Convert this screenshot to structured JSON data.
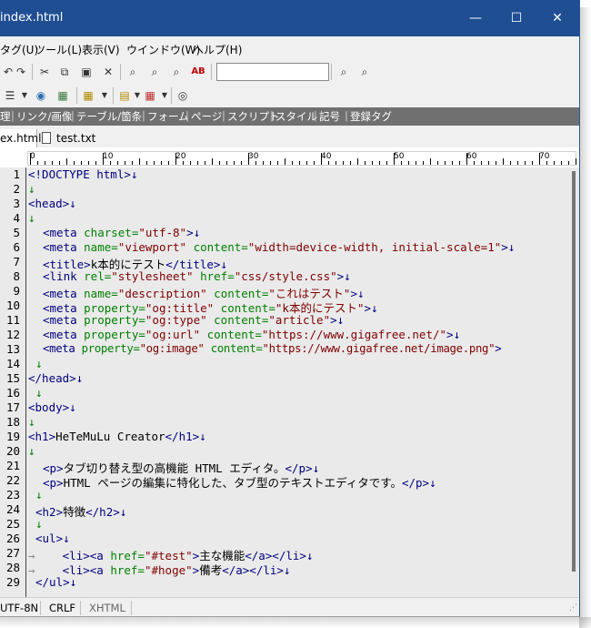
{
  "window": {
    "title": "index.html"
  },
  "title_controls": {
    "minimize": "—",
    "maximize": "☐",
    "close": "✕"
  },
  "menu": [
    "タグ(U)",
    "ツール(L)",
    "表示(V)",
    "ウインドウ(W)",
    "ヘルプ(H)"
  ],
  "tagbar": [
    "理",
    "リンク/画像",
    "テーブル/箇条",
    "フォーム",
    "ページ",
    "スクリプト",
    "スタイル",
    "記号",
    "登録タグ"
  ],
  "tabs": [
    {
      "label": "ex.html",
      "active": true
    },
    {
      "label": "test.txt",
      "active": false
    }
  ],
  "ruler": [
    "0",
    "10",
    "20",
    "30",
    "40",
    "50",
    "60",
    "70"
  ],
  "line_numbers": [
    "1",
    "2",
    "3",
    "4",
    "5",
    "6",
    "7",
    "8",
    "9",
    "10",
    "11",
    "12",
    "13",
    "14",
    "15",
    "16",
    "17",
    "18",
    "19",
    "20",
    "21",
    "22",
    "23",
    "24",
    "25",
    "26",
    "27",
    "28",
    "29"
  ],
  "code": {
    "l1": "<!DOCTYPE html>↓",
    "l2": "↓",
    "l3": "<head>↓",
    "l4": "↓",
    "l5_tag": "<meta ",
    "l5_attr": "charset=",
    "l5_val": "\"utf-8\"",
    "l5_end": ">↓",
    "l6_tag": "<meta ",
    "l6_attr1": "name=",
    "l6_val1": "\"viewport\"",
    "l6_attr2": " content=",
    "l6_val2": "\"width=device-width, initial-scale=1\"",
    "l6_end": ">↓",
    "l7_open": "<title>",
    "l7_text": "k本的にテスト",
    "l7_close": "</title>↓",
    "l8_tag": "<link ",
    "l8_attr1": "rel=",
    "l8_val1": "\"stylesheet\"",
    "l8_attr2": " href=",
    "l8_val2": "\"css/style.css\"",
    "l8_end": ">↓",
    "l9_tag": "<meta ",
    "l9_attr1": "name=",
    "l9_val1": "\"description\"",
    "l9_attr2": " content=",
    "l9_val2": "\"これはテスト\"",
    "l9_end": ">↓",
    "l10_tag": "<meta ",
    "l10_attr1": "property=",
    "l10_val1": "\"og:title\"",
    "l10_attr2": " content=",
    "l10_val2": "\"k本的にテスト\"",
    "l10_end": ">↓",
    "l11_tag": "<meta ",
    "l11_attr1": "property=",
    "l11_val1": "\"og:type\"",
    "l11_attr2": " content=",
    "l11_val2": "\"article\"",
    "l11_end": ">↓",
    "l12_tag": "<meta ",
    "l12_attr1": "property=",
    "l12_val1": "\"og:url\"",
    "l12_attr2": " content=",
    "l12_val2": "\"https://www.gigafree.net/\"",
    "l12_end": ">↓",
    "l13_tag": "<meta ",
    "l13_attr1": "property=",
    "l13_val1": "\"og:image\"",
    "l13_attr2": " content=",
    "l13_val2": "\"https://www.gigafree.net/image.png\"",
    "l13_end": ">",
    "l14": "↓",
    "l15": "</head>↓",
    "l16": "↓",
    "l17": "<body>↓",
    "l18": "↓",
    "l19_open": "<h1>",
    "l19_text": "HeTeMuLu Creator",
    "l19_close": "</h1>↓",
    "l20": "↓",
    "l21_open": "<p>",
    "l21_text": "タブ切り替え型の高機能 HTML エディタ。",
    "l21_close": "</p>↓",
    "l22_open": "<p>",
    "l22_text": "HTML ページの編集に特化した、タブ型のテキストエディタです。",
    "l22_close": "</p>↓",
    "l23": "↓",
    "l24_open": "<h2>",
    "l24_text": "特徴",
    "l24_close": "</h2>↓",
    "l25": "↓",
    "l26": "<ul>↓",
    "l27_open": "<li><a ",
    "l27_attr": "href=",
    "l27_val": "\"#test\"",
    "l27_mid": ">",
    "l27_text": "主な機能",
    "l27_close": "</a></li>↓",
    "l28_open": "<li><a ",
    "l28_attr": "href=",
    "l28_val": "\"#hoge\"",
    "l28_mid": ">",
    "l28_text": "備考",
    "l28_close": "</a></li>↓",
    "l29": "</ul>↓",
    "tab_marker": "→"
  },
  "status": {
    "encoding": "UTF-8N",
    "line_ending": "CRLF",
    "mode": "XHTML"
  },
  "colors": {
    "titlebar": "#1f4e93",
    "tag": "#000080",
    "attr": "#008000",
    "value": "#800000",
    "tagbar": "#707070"
  }
}
